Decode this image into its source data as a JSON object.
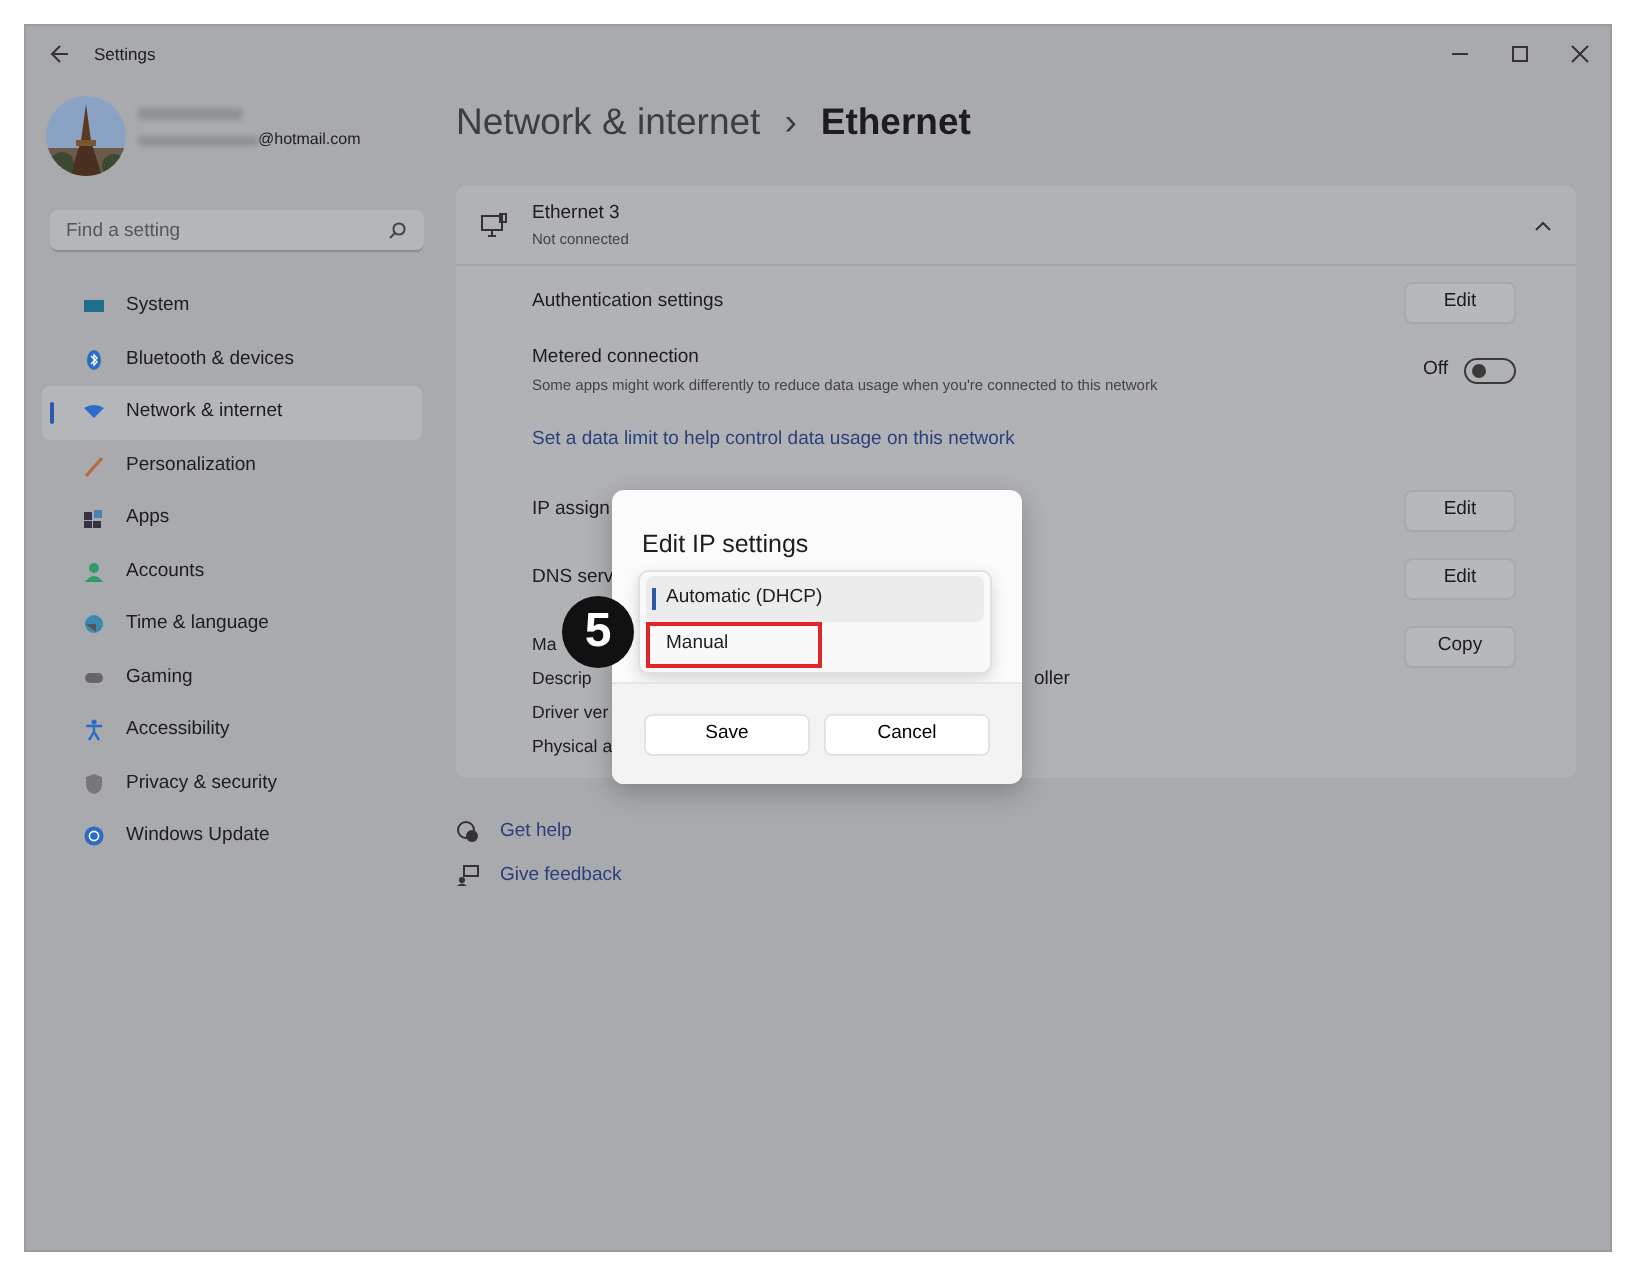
{
  "window": {
    "title": "Settings"
  },
  "account": {
    "email": "@hotmail.com"
  },
  "search": {
    "placeholder": "Find a setting"
  },
  "sidebar": {
    "items": [
      {
        "label": "System",
        "selected": false
      },
      {
        "label": "Bluetooth & devices",
        "selected": false
      },
      {
        "label": "Network & internet",
        "selected": true
      },
      {
        "label": "Personalization",
        "selected": false
      },
      {
        "label": "Apps",
        "selected": false
      },
      {
        "label": "Accounts",
        "selected": false
      },
      {
        "label": "Time & language",
        "selected": false
      },
      {
        "label": "Gaming",
        "selected": false
      },
      {
        "label": "Accessibility",
        "selected": false
      },
      {
        "label": "Privacy & security",
        "selected": false
      },
      {
        "label": "Windows Update",
        "selected": false
      }
    ]
  },
  "breadcrumb": {
    "parent": "Network & internet",
    "separator": "›",
    "current": "Ethernet"
  },
  "adapter": {
    "name": "Ethernet 3",
    "status": "Not connected",
    "expanded": true
  },
  "rows": [
    {
      "kind": "button",
      "label": "Authentication settings",
      "action": "Edit"
    },
    {
      "kind": "toggle",
      "label": "Metered connection",
      "description": "Some apps might work differently to reduce data usage when you're connected to this network",
      "state_text": "Off",
      "on": false
    },
    {
      "kind": "link",
      "label": "Set a data limit to help control data usage on this network"
    },
    {
      "kind": "button",
      "label": "IP assign",
      "action": "Edit"
    },
    {
      "kind": "button",
      "label": "DNS serv",
      "action": "Edit"
    },
    {
      "kind": "props",
      "properties": [
        {
          "label": "Ma"
        },
        {
          "label": "Descrip",
          "value": "oller"
        },
        {
          "label": "Driver ver"
        },
        {
          "label": "Physical a"
        }
      ],
      "action": "Copy"
    }
  ],
  "help_links": [
    "Get help",
    "Give feedback"
  ],
  "dialog": {
    "title": "Edit IP settings",
    "options": [
      {
        "label": "Automatic (DHCP)",
        "selected": true,
        "highlighted": false
      },
      {
        "label": "Manual",
        "selected": false,
        "highlighted": true
      }
    ],
    "buttons": [
      "Save",
      "Cancel"
    ]
  },
  "callout": {
    "number": "5"
  }
}
